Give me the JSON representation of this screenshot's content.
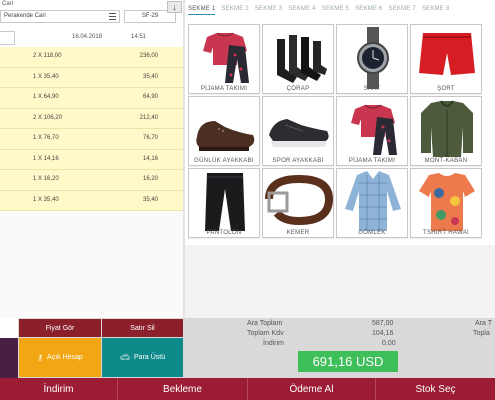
{
  "header": {
    "cari_label": "Cari",
    "customer": "Perakende Cari",
    "doc_no": "SF-29",
    "date": "16.04.2018",
    "time": "14:51"
  },
  "items": [
    {
      "qty": "2 X 118,00",
      "total": "236,00"
    },
    {
      "qty": "1 X 35,40",
      "total": "35,40"
    },
    {
      "qty": "1 X 64,90",
      "total": "64,90"
    },
    {
      "qty": "2 X 106,20",
      "total": "212,40"
    },
    {
      "qty": "1 X 76,70",
      "total": "76,70"
    },
    {
      "qty": "1 X 14,16",
      "total": "14,16"
    },
    {
      "qty": "1 X 16,20",
      "total": "16,20"
    },
    {
      "qty": "1 X 35,40",
      "total": "35,40"
    }
  ],
  "tabs": [
    "SEKME 1",
    "SEKME 2",
    "SEKME 3",
    "SEKME 4",
    "SEKME 5",
    "SEKME 6",
    "SEKME 7",
    "SEKME 8"
  ],
  "products": [
    {
      "label": "PİJAMA TAKIMI",
      "icon": "pajama-icon"
    },
    {
      "label": "ÇORAP",
      "icon": "socks-icon"
    },
    {
      "label": "SAAT",
      "icon": "watch-icon"
    },
    {
      "label": "ŞORT",
      "icon": "shorts-icon"
    },
    {
      "label": "GÜNLÜK AYAKKABI",
      "icon": "dress-shoe-icon"
    },
    {
      "label": "SPOR AYAKKABI",
      "icon": "sneaker-icon"
    },
    {
      "label": "PİJAMA TAKIMI",
      "icon": "pajama-icon"
    },
    {
      "label": "MONT-KABAN",
      "icon": "jacket-icon"
    },
    {
      "label": "PANTOLON",
      "icon": "trousers-icon"
    },
    {
      "label": "KEMER",
      "icon": "belt-icon"
    },
    {
      "label": "GÖMLEK",
      "icon": "shirt-icon"
    },
    {
      "label": "TSHIRT HAWAI",
      "icon": "tshirt-icon"
    }
  ],
  "actions": {
    "fiyat_gor": "Fiyat Gör",
    "satir_sil": "Satır Sil",
    "acik_hesap": "Açık Hesap",
    "para_ustu": "Para Üstü"
  },
  "totals": {
    "ara_toplam_label": "Ara Toplam",
    "ara_toplam": "587,00",
    "toplam_kdv_label": "Toplam Kdv",
    "toplam_kdv": "104,16",
    "indirim_label": "İndirim",
    "indirim": "0,00",
    "grand_total": "691,16 USD",
    "right_ara_label": "Ara T",
    "right_top_label": "Topla"
  },
  "bottom_bar": {
    "indirim": "İndirim",
    "bekleme": "Bekleme",
    "odeme_al": "Ödeme Al",
    "stok_sec": "Stok Seç"
  },
  "colors": {
    "item_row": "#fff8c8",
    "action_red": "#8b1f2a",
    "action_orange": "#f3a613",
    "action_teal": "#0f8a8a",
    "total_green": "#3fbf5a",
    "bottom_bar": "#9b1c34"
  }
}
